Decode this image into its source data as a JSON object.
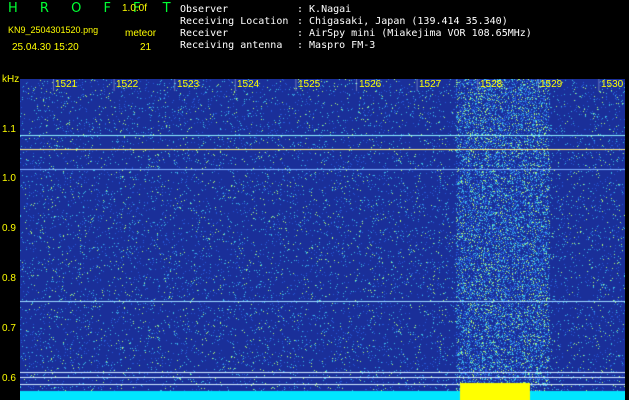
{
  "logo": {
    "text": "H R O F F T"
  },
  "version": "1.0.0f",
  "filename": "KN9_2504301520.png",
  "meteor_label": "meteor",
  "meteor_count": "21",
  "datetime": "25.04.30 15:20",
  "info": {
    "observer_label": "Observer",
    "observer_value": ": K.Nagai",
    "location_label": "Receiving Location",
    "location_value": ": Chigasaki, Japan (139.414 35.340)",
    "receiver_label": "Receiver",
    "receiver_value": ": AirSpy mini (Miakejima VOR 108.65MHz)",
    "antenna_label": "Receiving antenna",
    "antenna_value": ": Maspro FM-3"
  },
  "y_axis": {
    "unit": "kHz",
    "ticks": [
      "1.1",
      "1.0",
      "0.9",
      "0.8",
      "0.7",
      "0.6"
    ]
  },
  "minutes": [
    "1521",
    "1522",
    "1523",
    "1524",
    "1525",
    "1526",
    "1527",
    "1528",
    "1529",
    "1530"
  ],
  "colors": {
    "axis_text": "#ffff00",
    "logo": "#00ff33",
    "background": "#1a2f99"
  }
}
